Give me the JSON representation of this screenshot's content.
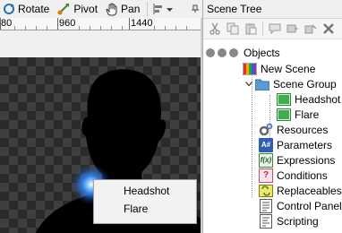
{
  "toolbar": {
    "rotate_label": "Rotate",
    "pivot_label": "Pivot",
    "pan_label": "Pan",
    "icons": {
      "rotate": "rotate-icon",
      "pivot": "pivot-icon",
      "pan": "hand-icon",
      "align": "align-icon",
      "chevron": "chevron-down-icon",
      "pin": "pin-icon"
    }
  },
  "ruler": {
    "labels": [
      "80",
      "960",
      "1440"
    ]
  },
  "context_menu": {
    "items": [
      "Headshot",
      "Flare"
    ]
  },
  "panel": {
    "title": "Scene Tree",
    "toolbar_icons": [
      "cut-icon",
      "copy-icon",
      "paste-icon",
      "comment-icon",
      "duplicate-icon",
      "undo-icon",
      "delete-icon"
    ],
    "header_icons": [
      "filter-icon",
      "lock-icon",
      "visibility-icon"
    ]
  },
  "tree": {
    "root_label": "Objects",
    "new_scene": "New Scene",
    "scene_group": "Scene Group",
    "headshot": "Headshot",
    "flare": "Flare",
    "resources": "Resources",
    "parameters": "Parameters",
    "expressions": "Expressions",
    "conditions": "Conditions",
    "replaceables": "Replaceables",
    "control_panel": "Control Panel",
    "scripting": "Scripting"
  },
  "colors": {
    "canvas_dark": "#2b2b2b",
    "canvas_light": "#3f3f3f",
    "flare_blue": "#4aa8ff",
    "folder_blue": "#5b9bd5"
  }
}
